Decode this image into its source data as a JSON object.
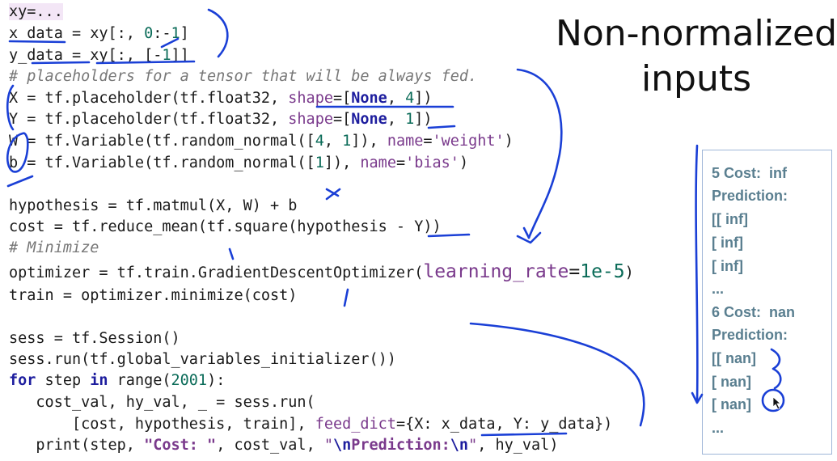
{
  "code": {
    "line1": "xy=...",
    "l2a": "x_data = xy[:, ",
    "l2b": "0",
    "l2c": ":-",
    "l2d": "1",
    "l2e": "]",
    "l3a": "y_data = xy[:, [-",
    "l3b": "1",
    "l3c": "]]",
    "line4": "# placeholders for a tensor that will be always fed.",
    "l5a": "X = tf.placeholder(tf.float32, ",
    "l5b": "shape",
    "l5c": "=[",
    "l5d": "None",
    "l5e": ", ",
    "l5f": "4",
    "l5g": "])",
    "l6a": "Y = tf.placeholder(tf.float32, ",
    "l6b": "shape",
    "l6c": "=[",
    "l6d": "None",
    "l6e": ", ",
    "l6f": "1",
    "l6g": "])",
    "l7a": "W = tf.Variable(tf.random_normal([",
    "l7b": "4",
    "l7c": ", ",
    "l7d": "1",
    "l7e": "]), ",
    "l7f": "name",
    "l7g": "=",
    "l7h": "'weight'",
    "l7i": ")",
    "l8a": "b = tf.Variable(tf.random_normal([",
    "l8b": "1",
    "l8c": "]), ",
    "l8d": "name",
    "l8e": "=",
    "l8f": "'bias'",
    "l8g": ")",
    "line9": "hypothesis = tf.matmul(X, W) + b",
    "line10": "cost = tf.reduce_mean(tf.square(hypothesis - Y))",
    "line11": "# Minimize",
    "l12a": "optimizer = tf.train.GradientDescentOptimizer(",
    "l12b": "learning_rate",
    "l12c": "=",
    "l12d": "1e-5",
    "l12e": ")",
    "line13": "train = optimizer.minimize(cost)",
    "line14": "sess = tf.Session()",
    "line15": "sess.run(tf.global_variables_initializer())",
    "l16a": "for",
    "l16b": " step ",
    "l16c": "in",
    "l16d": " range(",
    "l16e": "2001",
    "l16f": "):",
    "line17": "   cost_val, hy_val, _ = sess.run(",
    "l18a": "       [cost, hypothesis, train], ",
    "l18b": "feed_dict",
    "l18c": "={X: x_data, Y: y_data})",
    "l19a": "   print(step, ",
    "l19b": "\"Cost: \"",
    "l19c": ", cost_val, ",
    "l19d": "\"",
    "l19e": "\\n",
    "l19f": "Prediction:",
    "l19g": "\\n",
    "l19h": "\"",
    "l19i": ", hy_val)"
  },
  "title": {
    "line1": "Non-normalized",
    "line2": "inputs"
  },
  "output": [
    "5 Cost:  inf",
    "Prediction:",
    "[[ inf]",
    "[ inf]",
    "[ inf]",
    "...",
    "6 Cost:  nan",
    "Prediction:",
    "[[ nan]",
    "[ nan]",
    "[ nan]",
    "..."
  ],
  "colors": {
    "ink": "#1a3fd6",
    "panel_text": "#5a7f90",
    "keyword": "#1d1d9e",
    "string": "#7a3a8c"
  }
}
